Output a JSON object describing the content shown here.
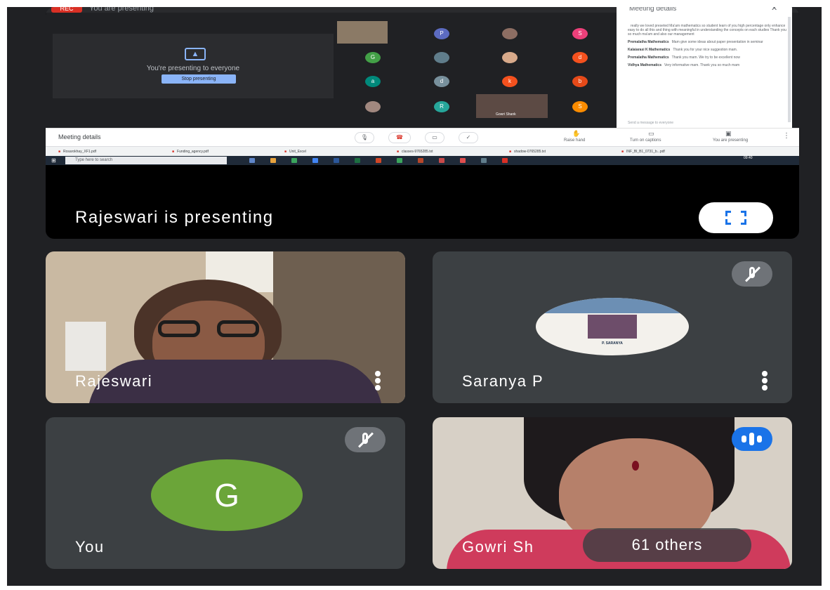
{
  "presentation": {
    "rec_label": "REC",
    "presenting_small": "You are presenting",
    "presenting_message": "You're presenting to everyone",
    "stop_button": "Stop presenting",
    "presenter_banner": "Rajeswari is presenting",
    "thumbnail_letters": [
      "P",
      "S",
      "G",
      "d",
      "a",
      "d",
      "k",
      "b",
      "R",
      "S"
    ],
    "thumbnail_name": "Gowri Shank"
  },
  "chat": {
    "title": "Meeting details",
    "close": "✕",
    "messages": [
      {
        "who": "",
        "text": "really we loved preseted Ma'am mathematics so student learn of you high percentage only enhance easy to do all this and thing with meaningful in understanding the concepts on each studies Thank you so much ma'am and also our management"
      },
      {
        "who": "Premalatha Mathematics",
        "text": "Mam give some ideas about paper presentation in seminar"
      },
      {
        "who": "Kalaiarasi K Mathematics",
        "text": "Thank you for your nice suggestion mam."
      },
      {
        "who": "Premalatha Mathematics",
        "text": "Thank you mam. We try to be excellent now"
      },
      {
        "who": "Vidhya Mathematics",
        "text": "Very informative mam. Thank you so much mam"
      }
    ],
    "input_placeholder": "Send a message to everyone"
  },
  "meeting_bar": {
    "details_label": "Meeting details",
    "raise_hand": "Raise hand",
    "captions": "Turn on captions",
    "you_are_presenting": "You are presenting"
  },
  "downloads": [
    "Rosarokhay_XF1.pdf",
    "Funding_agency.pdf",
    "Unit_Excel",
    "classes-9765285.txt",
    "shadow-0765285.txt",
    "INF_Bl_B1_0731_b...pdf"
  ],
  "taskbar": {
    "search_placeholder": "Type here to search",
    "clock": "09:40"
  },
  "tiles": [
    {
      "name": "Rajeswari"
    },
    {
      "name": "Saranya P",
      "avatar_text": "P. SARANYA"
    },
    {
      "name": "You",
      "initial": "G"
    },
    {
      "name": "Gowri Sh",
      "others": "61 others"
    }
  ],
  "colors": {
    "meet_dark": "#202124",
    "tile_gray": "#3c4043",
    "accent_blue": "#1a73e8",
    "avatar_green": "#6ba539",
    "rec_red": "#d93025"
  },
  "icons": [
    "present-screen-icon",
    "fullscreen-icon",
    "mic-off-icon",
    "more-vert-icon",
    "speaking-icon",
    "hand-icon",
    "captions-icon",
    "windows-icon"
  ]
}
